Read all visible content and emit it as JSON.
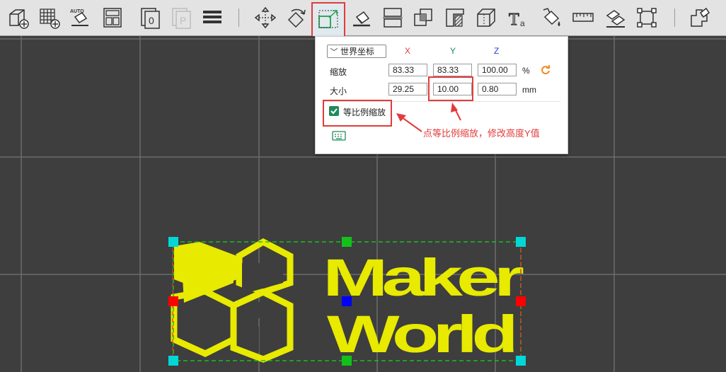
{
  "toolbar": {
    "tools": [
      {
        "name": "add-object-icon"
      },
      {
        "name": "add-plate-icon"
      },
      {
        "name": "auto-orient-icon",
        "label": "AUTO"
      },
      {
        "name": "arrange-icon"
      },
      {
        "name": "plate-o-icon",
        "label": "0"
      },
      {
        "name": "plate-p-icon",
        "label": "P"
      },
      {
        "name": "layers-icon"
      },
      {
        "name": "move-icon"
      },
      {
        "name": "rotate-icon"
      },
      {
        "name": "scale-icon"
      },
      {
        "name": "lay-on-face-icon"
      },
      {
        "name": "cut-icon"
      },
      {
        "name": "boolean-icon"
      },
      {
        "name": "support-paint-icon"
      },
      {
        "name": "seam-paint-icon"
      },
      {
        "name": "text-icon",
        "label": "Ta"
      },
      {
        "name": "color-paint-icon"
      },
      {
        "name": "measure-icon"
      },
      {
        "name": "assembly-icon"
      },
      {
        "name": "fit-view-icon"
      },
      {
        "name": "explode-icon"
      }
    ]
  },
  "scale_panel": {
    "coord_system": "世界坐标",
    "axis_x": "X",
    "axis_y": "Y",
    "axis_z": "Z",
    "scale_label": "缩放",
    "size_label": "大小",
    "scale_x": "83.33",
    "scale_y": "83.33",
    "scale_z": "100.00",
    "scale_unit": "%",
    "size_x": "29.25",
    "size_y": "10.00",
    "size_z": "0.80",
    "size_unit": "mm",
    "uniform_scale_label": "等比例缩放",
    "uniform_scale_checked": true
  },
  "annotation": {
    "text": "点等比例缩放，修改高度Y值"
  },
  "colors": {
    "canvas_bg": "#3e3e3e",
    "grid_line": "#6c6c6c",
    "model_yellow": "#e8ea00",
    "annotation_red": "#e23b3b",
    "handle_cyan": "#00d8d8",
    "handle_green": "#12c21a",
    "handle_red": "#ff0000",
    "handle_blue": "#0000ff",
    "checkbox_green": "#1e8a5a"
  },
  "model": {
    "line1": "Maker",
    "line2": "World"
  }
}
